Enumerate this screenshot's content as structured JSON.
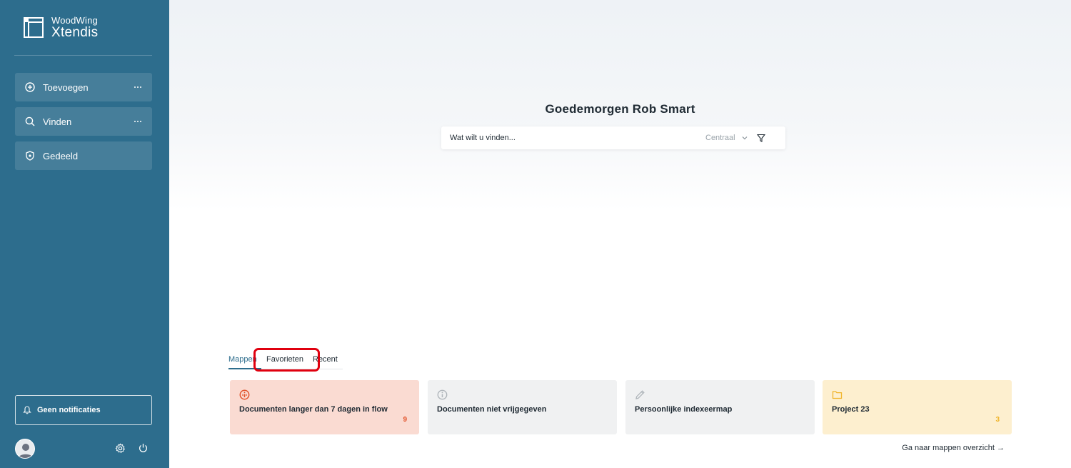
{
  "colors": {
    "sidebar_bg": "#2d6d8d",
    "accent": "#2d6d8d",
    "alert_red": "#e2542c",
    "folder_yellow": "#f0b42a",
    "highlight_red": "#e0000f"
  },
  "brand": {
    "company": "WoodWing",
    "product": "Xtendis"
  },
  "sidebar": {
    "items": [
      {
        "label": "Toevoegen",
        "icon": "plus-circle-icon",
        "has_more": true
      },
      {
        "label": "Vinden",
        "icon": "search-icon",
        "has_more": true
      },
      {
        "label": "Gedeeld",
        "icon": "shield-icon",
        "has_more": false
      }
    ],
    "notifications_label": "Geen notificaties",
    "footer_icons": [
      "avatar",
      "gear-icon",
      "power-icon"
    ]
  },
  "main": {
    "greeting": "Goedemorgen Rob Smart",
    "search": {
      "placeholder": "Wat wilt u vinden...",
      "scope": "Centraal"
    },
    "tabs": [
      {
        "label": "Mappen",
        "active": true
      },
      {
        "label": "Favorieten",
        "active": false,
        "highlighted": true
      },
      {
        "label": "Recent",
        "active": false
      }
    ],
    "cards": [
      {
        "title": "Documenten langer dan 7 dagen in flow",
        "count": "9",
        "icon": "alert-circle-icon"
      },
      {
        "title": "Documenten niet vrijgegeven",
        "count": "",
        "icon": "info-circle-icon"
      },
      {
        "title": "Persoonlijke indexeermap",
        "count": "",
        "icon": "pencil-icon"
      },
      {
        "title": "Project 23",
        "count": "3",
        "icon": "folder-icon"
      }
    ],
    "goto_link": "Ga naar mappen overzicht"
  }
}
